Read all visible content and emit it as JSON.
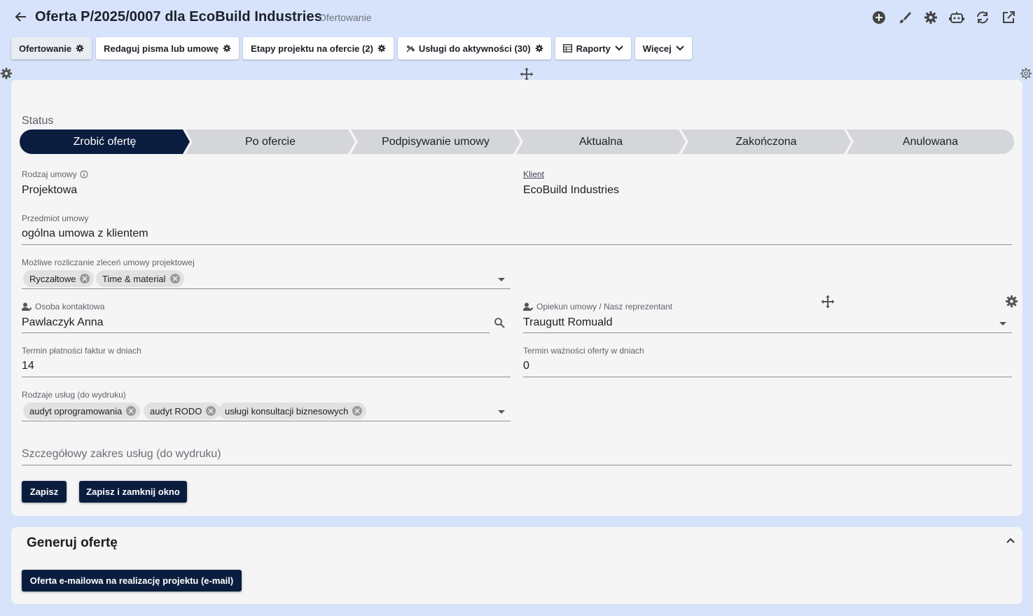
{
  "header": {
    "title": "Oferta P/2025/0007 dla EcoBuild Industries",
    "subtitle": "Ofertowanie",
    "icons": [
      "add-circle-icon",
      "brush-icon",
      "gear-icon",
      "robot-icon",
      "refresh-icon",
      "open-external-icon"
    ]
  },
  "tabs": [
    {
      "label": "Ofertowanie",
      "active": true
    },
    {
      "label": "Redaguj pisma lub umowę"
    },
    {
      "label": "Etapy projektu na ofercie (2)"
    },
    {
      "label": "Usługi do aktywności (30)"
    },
    {
      "label": "Raporty"
    },
    {
      "label": "Więcej"
    }
  ],
  "status": {
    "label": "Status",
    "steps": [
      "Zrobić ofertę",
      "Po ofercie",
      "Podpisywanie umowy",
      "Aktualna",
      "Zakończona",
      "Anulowana"
    ],
    "current": 0
  },
  "form": {
    "rodzaj_umowy": {
      "label": "Rodzaj umowy",
      "value": "Projektowa"
    },
    "klient": {
      "label": "Klient",
      "value": "EcoBuild Industries"
    },
    "przedmiot": {
      "label": "Przedmiot umowy",
      "value": "ogólna umowa z klientem"
    },
    "rozliczanie": {
      "label": "Możliwe rozliczanie zleceń umowy projektowej",
      "chips": [
        "Ryczałtowe",
        "Time & material"
      ]
    },
    "osoba": {
      "label": "Osoba kontaktowa",
      "value": "Pawlaczyk Anna"
    },
    "opiekun": {
      "label": "Opiekun umowy / Nasz reprezentant",
      "value": "Traugutt Romuald"
    },
    "termin_platnosci": {
      "label": "Termin płatności faktur w dniach",
      "value": "14"
    },
    "termin_waznosci": {
      "label": "Termin ważności oferty w dniach",
      "value": "0"
    },
    "rodzaje_uslug": {
      "label": "Rodzaje usług (do wydruku)",
      "chips": [
        "audyt oprogramowania",
        "audyt RODO",
        "usługi konsultacji biznesowych"
      ]
    },
    "zakres": {
      "placeholder": "Szczegółowy zakres usług (do wydruku)"
    }
  },
  "buttons": {
    "save": "Zapisz",
    "save_close": "Zapisz i zamknij okno"
  },
  "generate": {
    "title": "Generuj ofertę",
    "button": "Oferta e-mailowa na realizację projektu (e-mail)"
  },
  "colors": {
    "accent": "#0b1d3f",
    "background": "#d6e3fb",
    "card": "#f5f5f5"
  }
}
